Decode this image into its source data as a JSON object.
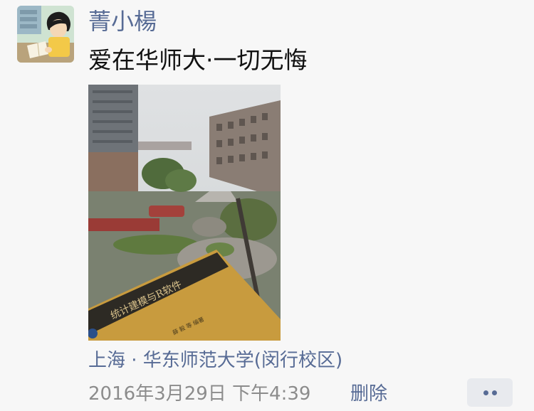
{
  "post": {
    "author": "菁小楊",
    "text": "爱在华师大·一切无悔",
    "image": {
      "book_title": "统计建模与R软件",
      "book_author": "薛 毅 等 编著"
    },
    "location": "上海 · 华东师范大学(闵行校区)",
    "timestamp": "2016年3月29日 下午4:39",
    "delete_label": "删除",
    "more_icon": "ellipsis-icon"
  },
  "colors": {
    "link": "#576b95",
    "text": "#111111",
    "meta": "#8c8c8c",
    "background": "#f7f7f7",
    "more_button_bg": "#e8eaee"
  }
}
